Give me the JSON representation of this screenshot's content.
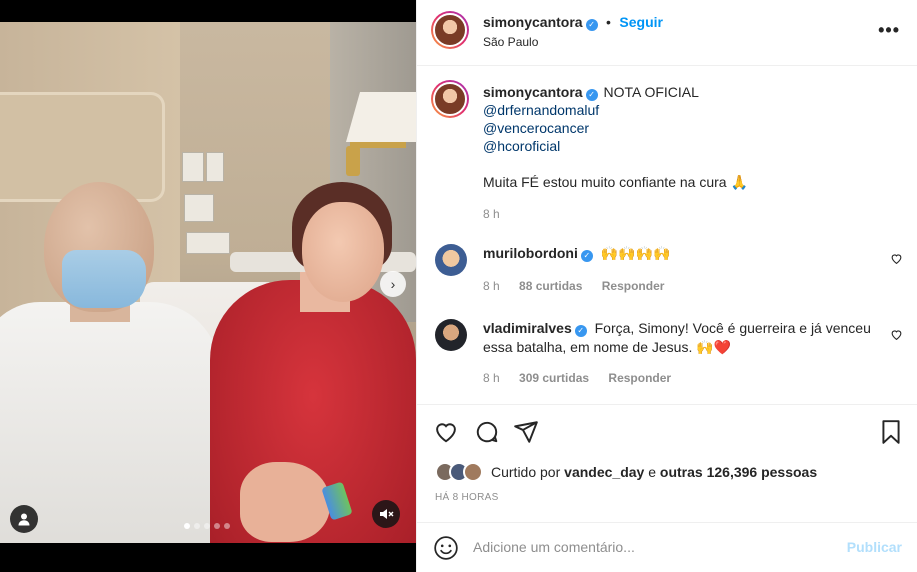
{
  "post": {
    "username": "simonycantora",
    "follow_label": "Seguir",
    "location": "São Paulo",
    "more_label": "•••"
  },
  "caption": {
    "username": "simonycantora",
    "title": "NOTA OFICIAL",
    "mentions": [
      "@drfernandomaluf",
      "@vencerocancer",
      "@hcoroficial"
    ],
    "text": "Muita FÉ estou muito confiante na cura 🙏",
    "time": "8 h"
  },
  "comments": [
    {
      "username": "murilobordoni",
      "text": "🙌🙌🙌🙌",
      "time": "8 h",
      "likes": "88 curtidas",
      "reply": "Responder"
    },
    {
      "username": "vladimiralves",
      "text": "Força, Simony! Você é guerreira e já venceu essa batalha, em nome de Jesus. 🙌❤️",
      "time": "8 h",
      "likes": "309 curtidas",
      "reply": "Responder"
    }
  ],
  "likes": {
    "prefix": "Curtido por",
    "user": "vandec_day",
    "conj": "e",
    "others": "outras 126,396 pessoas"
  },
  "timestamp": "HÁ 8 HORAS",
  "composer": {
    "placeholder": "Adicione um comentário...",
    "publish_label": "Publicar"
  },
  "carousel": {
    "count": 5,
    "active": 0
  },
  "colors": {
    "link": "#0095f6",
    "mention": "#00376b",
    "verified": "#3897f0",
    "muted": "#8e8e8e"
  },
  "icons": [
    "heart-icon",
    "comment-icon",
    "share-icon",
    "bookmark-icon",
    "emoji-icon",
    "user-tag-icon",
    "mute-icon",
    "chevron-right-icon",
    "verified-icon"
  ]
}
